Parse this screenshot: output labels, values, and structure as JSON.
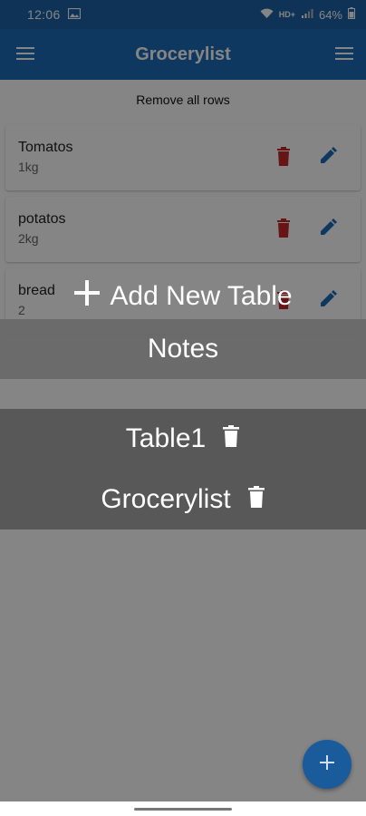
{
  "status_bar": {
    "time": "12:06",
    "network": "HD+",
    "battery": "64%"
  },
  "app_bar": {
    "title": "Grocerylist"
  },
  "list": {
    "remove_all_label": "Remove all rows",
    "rows": [
      {
        "name": "Tomatos",
        "quantity": "1kg"
      },
      {
        "name": "potatos",
        "quantity": "2kg"
      },
      {
        "name": "bread",
        "quantity": "2"
      }
    ]
  },
  "overlay_menu": {
    "add_table_label": "Add New Table",
    "notes_label": "Notes",
    "tables": [
      {
        "name": "Table1"
      },
      {
        "name": "Grocerylist"
      }
    ]
  },
  "colors": {
    "app_bar": "#1e6bb8",
    "status_bar": "#1e62a6",
    "delete_icon": "#c62828",
    "edit_icon": "#1e6bb8",
    "fab": "#1a5b9c"
  }
}
